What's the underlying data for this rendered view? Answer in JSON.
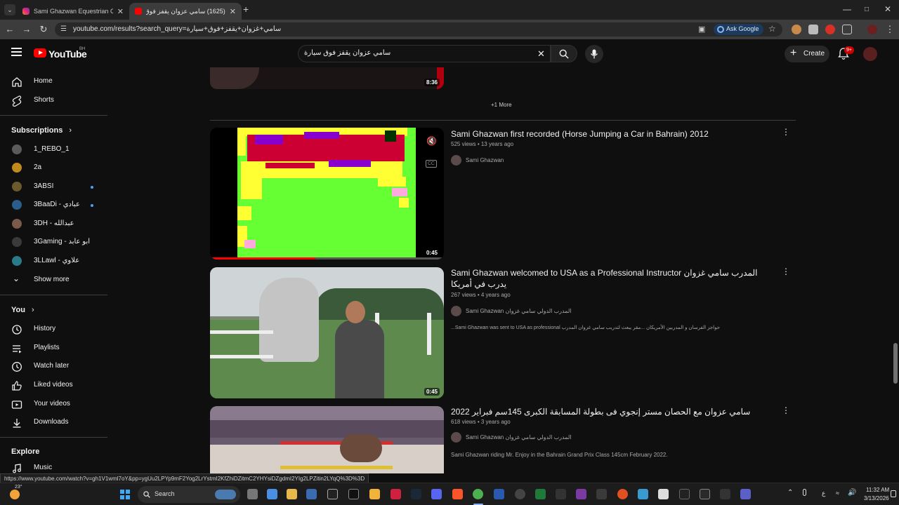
{
  "browser": {
    "tabs": [
      {
        "title": "Sami Ghazwan Equestrian Cent",
        "active": false
      },
      {
        "title": "(1625) سامي عزوان يقفز فوق سيا",
        "active": true
      }
    ],
    "new_tab_label": "+",
    "url": "youtube.com/results?search_query=سامي+غزوان+يقفز+فوق+سيارة",
    "ask_google_label": "Ask Google"
  },
  "youtube": {
    "logo_text": "YouTube",
    "country_code": "BH",
    "search_query": "سامي عزوان يقفز فوق سيارة",
    "create_label": "Create",
    "notification_count": "9+"
  },
  "sidebar": {
    "main": [
      {
        "label": "Home",
        "icon": "home-icon"
      },
      {
        "label": "Shorts",
        "icon": "shorts-icon"
      }
    ],
    "subscriptions_label": "Subscriptions",
    "subscriptions": [
      {
        "label": "1_REBO_1",
        "color": "#5b5b5b",
        "dot": false
      },
      {
        "label": "2a",
        "color": "#c08a1e",
        "dot": false
      },
      {
        "label": "3ABSI",
        "color": "#6b5a2e",
        "dot": true
      },
      {
        "label": "3BaaDi - عبادي",
        "color": "#2a5d8a",
        "dot": true
      },
      {
        "label": "3DH - عبدالله",
        "color": "#7a5a4a",
        "dot": false
      },
      {
        "label": "3Gaming - ابو عابد",
        "color": "#3a3a3a",
        "dot": false
      },
      {
        "label": "3LLawl - علاوي",
        "color": "#2a7a8a",
        "dot": false
      }
    ],
    "show_more_label": "Show more",
    "you_label": "You",
    "you_items": [
      {
        "label": "History",
        "icon": "history-icon"
      },
      {
        "label": "Playlists",
        "icon": "playlists-icon"
      },
      {
        "label": "Watch later",
        "icon": "watch-later-icon"
      },
      {
        "label": "Liked videos",
        "icon": "liked-videos-icon"
      },
      {
        "label": "Your videos",
        "icon": "your-videos-icon"
      },
      {
        "label": "Downloads",
        "icon": "downloads-icon"
      }
    ],
    "explore_label": "Explore",
    "explore_items": [
      {
        "label": "Music",
        "icon": "music-icon"
      }
    ]
  },
  "results": {
    "top_duration": "8:36",
    "more_label": "+1 More",
    "videos": [
      {
        "title": "Sami Ghazwan first recorded (Horse Jumping a Car in Bahrain) 2012",
        "views": "525 views",
        "age": "13 years ago",
        "channel": "Sami Ghazwan",
        "description": "",
        "duration": "0:45",
        "watched_fraction": 0.45
      },
      {
        "title": "Sami Ghazwan welcomed to USA as a Professional Instructor المدرب سامي غزوان يدرب في أمريكا",
        "views": "267 views",
        "age": "4 years ago",
        "channel": "Sami Ghazwan المدرب الدولي سامي غزوان",
        "description": "...Sami Ghazwan was sent to USA as professional حواجز الفرسان و المدربين الأمريكان ...مقر يبعث لتدريب سامي غزوان المدرب",
        "duration": "0:45"
      },
      {
        "title": "سامي عزوان مع الحصان مستر إنجوي فى بطولة المسابقة الكبرى 145سم فبراير 2022",
        "views": "618 views",
        "age": "3 years ago",
        "channel": "Sami Ghazwan المدرب الدولي سامي غزوان",
        "description": "Sami Ghazwan riding Mr. Enjoy in the Bahrain Grand Prix Class 145cm February 2022.",
        "duration": ""
      }
    ],
    "meta_separator": "•"
  },
  "status_url": "https://www.youtube.com/watch?v=gh1V1wml7oY&pp=ygUu2LPYp9mF2Yog2LrYstmI2KfZhiDZitmC2YHYsiDZgdmI2YIg2LPZitin2LYqQ%3D%3D",
  "taskbar": {
    "weather_temp": "23°",
    "search_label": "Search",
    "time": "11:32 AM",
    "date": "3/13/2026",
    "lang": "ع"
  }
}
